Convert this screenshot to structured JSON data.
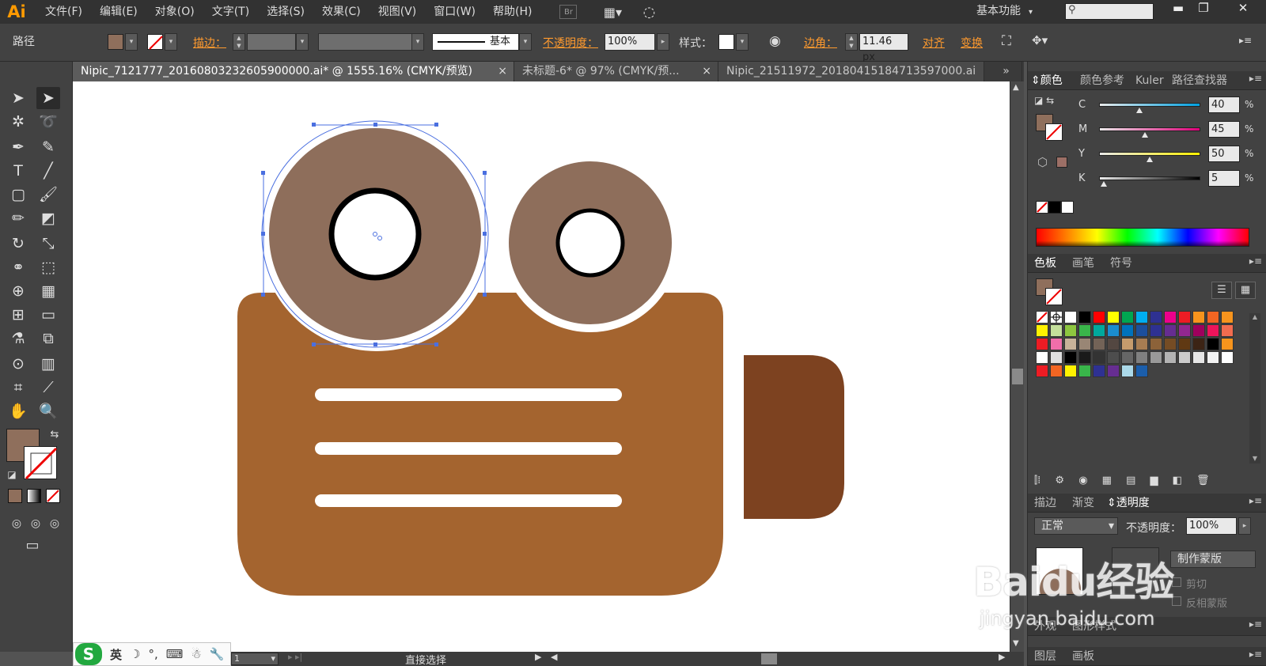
{
  "app": {
    "logo": "Ai"
  },
  "menu": {
    "items": [
      "文件(F)",
      "编辑(E)",
      "对象(O)",
      "文字(T)",
      "选择(S)",
      "效果(C)",
      "视图(V)",
      "窗口(W)",
      "帮助(H)"
    ],
    "bridge_label": "Br",
    "workspace_label": "基本功能"
  },
  "control_bar": {
    "object_type": "路径",
    "stroke_label": "描边：",
    "stroke_style_label": "基本",
    "opacity_label": "不透明度：",
    "opacity_value": "100%",
    "style_label": "样式：",
    "corner_label": "边角：",
    "corner_value": "11.46 px",
    "align_label": "对齐",
    "transform_label": "变换",
    "fill_color": "#8f6f5c"
  },
  "document_tabs": [
    {
      "title": "Nipic_7121777_20160803232605900000.ai* @ 1555.16% (CMYK/预览)",
      "active": true
    },
    {
      "title": "未标题-6* @ 97% (CMYK/预...",
      "active": false
    },
    {
      "title": "Nipic_21511972_20180415184713597000.ai",
      "active": false
    }
  ],
  "tab_overflow": "»",
  "artwork_colors": {
    "camera_body": "#a4642f",
    "lens": "#7d4220",
    "reel": "#8e6e5b",
    "reel_hole_stroke": "#000000",
    "stripe": "#ffffff",
    "selection": "#4a6fe0"
  },
  "panels": {
    "color": {
      "tabs": [
        "颜色",
        "颜色参考",
        "Kuler",
        "路径查找器"
      ],
      "channels": [
        {
          "name": "C",
          "value": "40",
          "level": 0.4,
          "gradient": "linear-gradient(to right,#e9e9e9,#00a0e0)"
        },
        {
          "name": "M",
          "value": "45",
          "level": 0.45,
          "gradient": "linear-gradient(to right,#e9e9e9,#e0007a)"
        },
        {
          "name": "Y",
          "value": "50",
          "level": 0.5,
          "gradient": "linear-gradient(to right,#e9e9e9,#fff000)"
        },
        {
          "name": "K",
          "value": "5",
          "level": 0.05,
          "gradient": "linear-gradient(to right,#e9e9e9,#000000)"
        }
      ],
      "percent_sign": "%",
      "swatch_color": "#8f6f5c"
    },
    "swatches": {
      "tabs": [
        "色板",
        "画笔",
        "符号"
      ],
      "rows": [
        [
          "none",
          "reg",
          "#ffffff",
          "#000000",
          "#ff0000",
          "#ffff00",
          "#00a651",
          "#00aeef",
          "#2e3192",
          "#ec008c",
          "#ed1c24",
          "#f7941d",
          "#f26522",
          "#f7941d"
        ],
        [
          "#fff200",
          "#c4df9b",
          "#8dc63f",
          "#39b54a",
          "#00a99d",
          "#1b8dce",
          "#0072bc",
          "#1c4f9c",
          "#2e3192",
          "#662d91",
          "#92278f",
          "#9e005d",
          "#ed145b",
          "#f26c4f"
        ],
        [
          "#ed1c24",
          "#f06eaa",
          "#c7b299",
          "#998675",
          "#736357",
          "#534741",
          "#c69c6d",
          "#a67c52",
          "#8c6239",
          "#754c24",
          "#603913",
          "#3c2415",
          "#000000",
          "#f7941d"
        ],
        [
          "#ffffff",
          "#e0e0e0",
          "#000000",
          "#1a1a1a",
          "#333333",
          "#4d4d4d",
          "#666666",
          "#808080",
          "#999999",
          "#b3b3b3",
          "#cccccc",
          "#e6e6e6",
          "#f2f2f2",
          "#ffffff"
        ],
        [
          "#ed1c24",
          "#f26522",
          "#fff200",
          "#39b54a",
          "#2e3192",
          "#662d91",
          "#abd9e9",
          "#1b5eab"
        ]
      ]
    },
    "transparency": {
      "tabs": [
        "描边",
        "渐变",
        "透明度"
      ],
      "blend_mode": "正常",
      "opacity_label": "不透明度：",
      "opacity_value": "100%",
      "make_mask_button": "制作蒙版",
      "clip_label": "剪切",
      "invert_mask_label": "反相蒙版"
    },
    "appearance": {
      "tabs": [
        "外观",
        "图形样式"
      ]
    },
    "layers": {
      "tabs": [
        "图层",
        "画板"
      ]
    }
  },
  "status_bar": {
    "zoom_value": "1",
    "tool_name": "直接选择"
  },
  "ime": {
    "logo": "S",
    "mode": "英"
  },
  "watermark": {
    "main": "Baidu经验",
    "sub": "jingyan.baidu.com"
  }
}
